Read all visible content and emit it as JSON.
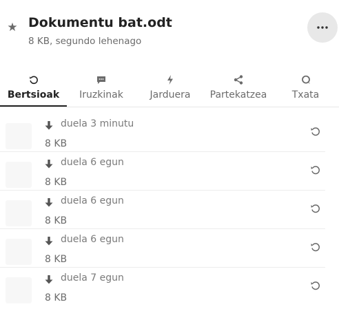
{
  "file": {
    "title": "Dokumentu bat.odt",
    "subtitle": "8 KB, segundo lehenago"
  },
  "tabs": [
    {
      "label": "Bertsioak",
      "icon": "history-icon",
      "active": true
    },
    {
      "label": "Iruzkinak",
      "icon": "comment-icon",
      "active": false
    },
    {
      "label": "Jarduera",
      "icon": "flash-icon",
      "active": false
    },
    {
      "label": "Partekatzea",
      "icon": "share-icon",
      "active": false
    },
    {
      "label": "Txata",
      "icon": "chat-icon",
      "active": false
    }
  ],
  "versions": [
    {
      "when": "duela 3 minutu",
      "size": "8 KB"
    },
    {
      "when": "duela 6 egun",
      "size": "8 KB"
    },
    {
      "when": "duela 6 egun",
      "size": "8 KB"
    },
    {
      "when": "duela 6 egun",
      "size": "8 KB"
    },
    {
      "when": "duela 7 egun",
      "size": "8 KB"
    }
  ],
  "colors": {
    "text": "#222222",
    "muted": "#6b6b6b",
    "more_button_bg": "#e8e8e8"
  }
}
